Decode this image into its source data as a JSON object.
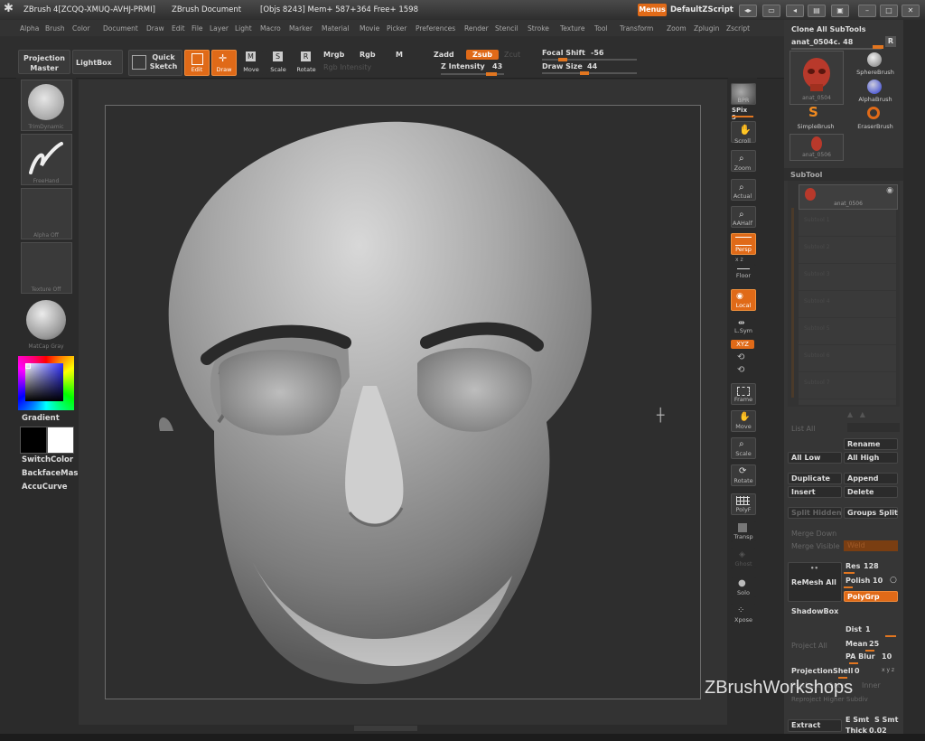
{
  "titlebar": {
    "app_name": "ZBrush 4[ZCQQ-XMUQ-AVHJ-PRMI]",
    "document": "ZBrush Document",
    "stats": "[Objs 8243]  Mem+ 587+364  Free+ 1598",
    "menus_button": "Menus",
    "script_label": "DefaultZScript"
  },
  "menubar": {
    "items": [
      "Alpha",
      "Brush",
      "Color",
      "Document",
      "Draw",
      "Edit",
      "File",
      "Layer",
      "Light",
      "Macro",
      "Marker",
      "Material",
      "Movie",
      "Picker",
      "Preferences",
      "Render",
      "Stencil",
      "Stroke",
      "Texture",
      "Tool",
      "Transform",
      "Zoom",
      "Zplugin",
      "Zscript"
    ]
  },
  "toolbar": {
    "projection_master": "Projection Master",
    "lightbox": "LightBox",
    "quick_sketch": "Quick Sketch",
    "edit": "Edit",
    "draw": "Draw",
    "move": "Move",
    "scale": "Scale",
    "rotate": "Rotate",
    "mrgb": "Mrgb",
    "rgb": "Rgb",
    "m": "M",
    "rgb_intensity": "Rgb Intensity",
    "zadd": "Zadd",
    "zsub": "Zsub",
    "zcut": "Zcut",
    "z_intensity_label": "Z Intensity",
    "z_intensity_value": "43",
    "focal_shift_label": "Focal Shift",
    "focal_shift_value": "-56",
    "draw_size_label": "Draw Size",
    "draw_size_value": "44"
  },
  "leftshelf": {
    "brush_caption": "TrimDynamic",
    "stroke_caption": "FreeHand",
    "alpha_caption": "Alpha  Off",
    "texture_caption": "Texture  Off",
    "material_caption": "MatCap Gray",
    "gradient": "Gradient",
    "switch_color": "SwitchColor",
    "backface_mask": "BackfaceMask",
    "accucurve": "AccuCurve"
  },
  "rightshelf": {
    "items": [
      "BPR",
      "SPix",
      "Scroll",
      "Zoom",
      "Actual",
      "AAHalf",
      "Persp",
      "Floor",
      "Local",
      "L.Sym",
      "XYZ",
      "Frame",
      "Move",
      "Scale",
      "Rotate",
      "PolyF",
      "Transp",
      "Ghost",
      "Solo",
      "Xpose"
    ],
    "spix_value": "3"
  },
  "toolpanel": {
    "clone_all": "Clone  All SubTools",
    "tool_name": "anat_0504c. 48",
    "r_button": "R",
    "brushes": [
      "SphereBrush",
      "AlphaBrush",
      "SimpleBrush",
      "EraserBrush"
    ],
    "current_tool_caption": "anat_0504",
    "small_tool_caption": "anat_0506",
    "subtool_header": "SubTool",
    "subtool_selected": "anat_0506",
    "empty_slots": [
      "Subtool 1",
      "Subtool 2",
      "Subtool 3",
      "Subtool 4",
      "Subtool 5",
      "Subtool 6",
      "Subtool 7"
    ],
    "list_all": "List All",
    "rename": "Rename",
    "all_low": "All Low",
    "all_high": "All High",
    "duplicate": "Duplicate",
    "append": "Append",
    "insert": "Insert",
    "delete": "Delete",
    "split_hidden": "Split Hidden",
    "groups_split": "Groups Split",
    "merge_down": "Merge Down",
    "merge_visible": "Merge Visible",
    "weld": "Weld",
    "remesh_all": "ReMesh  All",
    "res_label": "Res",
    "res_value": "128",
    "polish_label": "Polish",
    "polish_value": "10",
    "polygrp": "PolyGrp",
    "shadowbox": "ShadowBox",
    "project_all": "Project All",
    "dist_label": "Dist",
    "dist_value": "1",
    "mean_label": "Mean",
    "mean_value": "25",
    "pa_blur_label": "PA  Blur",
    "pa_blur_value": "10",
    "projection_shell_label": "ProjectionShell",
    "projection_shell_value": "0",
    "farthest": "Farthest",
    "outer": "Outer",
    "inner": "Inner",
    "reproject": "Reproject Higher Subdiv",
    "extract": "Extract",
    "e_smt": "E Smt",
    "s_smt": "S Smt",
    "thick_label": "Thick",
    "thick_value": "0.02"
  },
  "watermark": "ZBrushWorkshops"
}
